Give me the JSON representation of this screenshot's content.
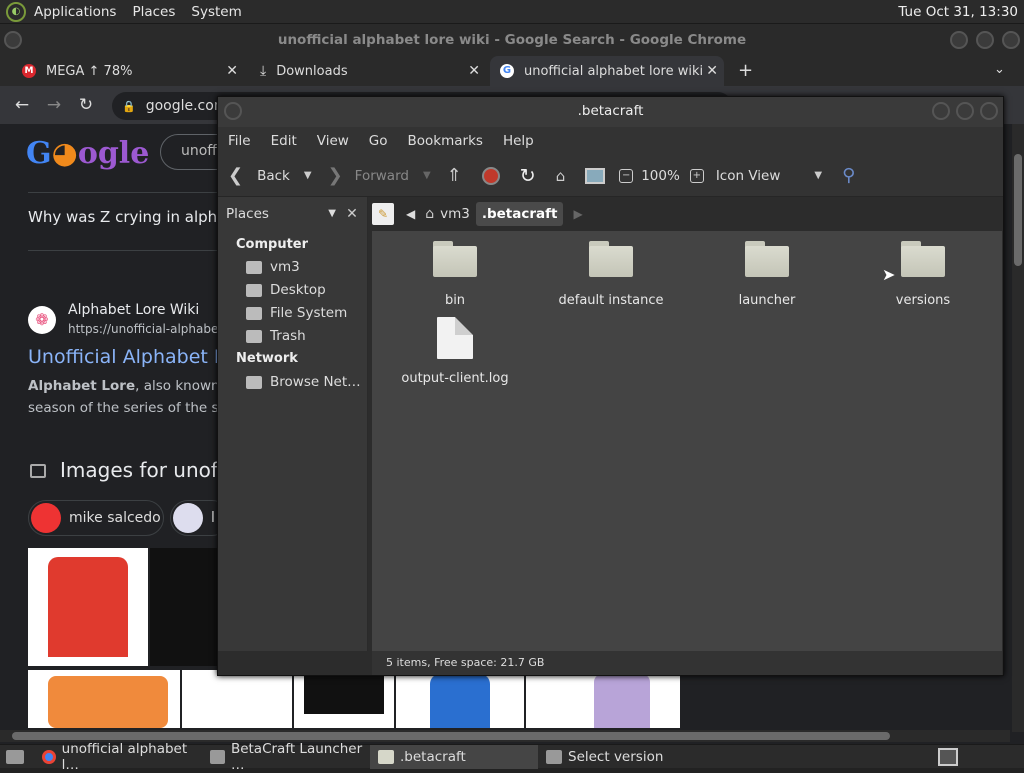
{
  "top_panel": {
    "menus": [
      "Applications",
      "Places",
      "System"
    ],
    "clock": "Tue Oct 31, 13:30"
  },
  "chrome": {
    "window_title": "unofficial alphabet lore wiki - Google Search - Google Chrome",
    "tabs": [
      {
        "label": "MEGA ↑ 78%",
        "icon": "mega-icon"
      },
      {
        "label": "Downloads",
        "icon": "download-icon"
      },
      {
        "label": "unofficial alphabet lore wiki - G",
        "icon": "google-icon"
      }
    ],
    "url": "google.com",
    "search_query": "unoffici",
    "question": "Why was Z crying in alphab",
    "result_site": "Alphabet Lore Wiki",
    "result_url": "https://unofficial-alphabet-lo",
    "result_title": "Unofficial Alphabet Lo",
    "snippet_bold": "Alphabet Lore",
    "snippet_rest": ", also known as A",
    "snippet_line2": "season of the series of the sam",
    "images_heading": "Images for unof",
    "chips": [
      "mike salcedo",
      "l"
    ]
  },
  "file_manager": {
    "title": ".betacraft",
    "menu": [
      "File",
      "Edit",
      "View",
      "Go",
      "Bookmarks",
      "Help"
    ],
    "toolbar": {
      "back": "Back",
      "forward": "Forward",
      "zoom": "100%",
      "view_mode": "Icon View"
    },
    "sidebar": {
      "selector": "Places",
      "sections": [
        {
          "heading": "Computer",
          "items": [
            "vm3",
            "Desktop",
            "File System",
            "Trash"
          ]
        },
        {
          "heading": "Network",
          "items": [
            "Browse Net…"
          ]
        }
      ]
    },
    "path": [
      "vm3",
      ".betacraft"
    ],
    "items": [
      {
        "name": "bin",
        "kind": "folder"
      },
      {
        "name": "default instance",
        "kind": "folder"
      },
      {
        "name": "launcher",
        "kind": "folder"
      },
      {
        "name": "versions",
        "kind": "folder"
      },
      {
        "name": "output-client.log",
        "kind": "file"
      }
    ],
    "status": "5 items, Free space: 21.7 GB"
  },
  "taskbar": {
    "tasks": [
      {
        "label": "unofficial alphabet l…",
        "icon": "chrome-icon"
      },
      {
        "label": "BetaCraft Launcher …",
        "icon": "app-icon"
      },
      {
        "label": ".betacraft",
        "icon": "folder-icon"
      },
      {
        "label": "Select version",
        "icon": "app-icon"
      }
    ]
  }
}
